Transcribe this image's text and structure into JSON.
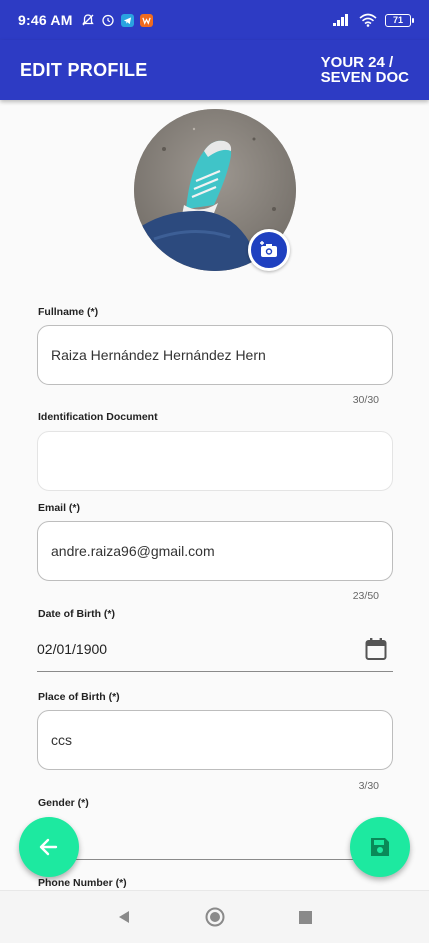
{
  "status_bar": {
    "time": "9:46 AM",
    "battery": "71"
  },
  "app_bar": {
    "title": "EDIT PROFILE",
    "logo_line1": "YOUR 24 /",
    "logo_line2": "SEVEN DOC"
  },
  "form": {
    "fullname": {
      "label": "Fullname (*)",
      "value": "Raiza Hernández Hernández Hern",
      "counter": "30/30"
    },
    "identification": {
      "label": "Identification Document",
      "value": ""
    },
    "email": {
      "label": "Email (*)",
      "value": "andre.raiza96@gmail.com",
      "counter": "23/50"
    },
    "dob": {
      "label": "Date of Birth (*)",
      "value": "02/01/1900"
    },
    "place_of_birth": {
      "label": "Place of Birth (*)",
      "value": "ccs",
      "counter": "3/30"
    },
    "gender": {
      "label": "Gender (*)",
      "value": ""
    },
    "phone": {
      "label": "Phone Number (*)"
    }
  },
  "colors": {
    "primary": "#2d3bc4",
    "fab": "#1de9a0"
  }
}
